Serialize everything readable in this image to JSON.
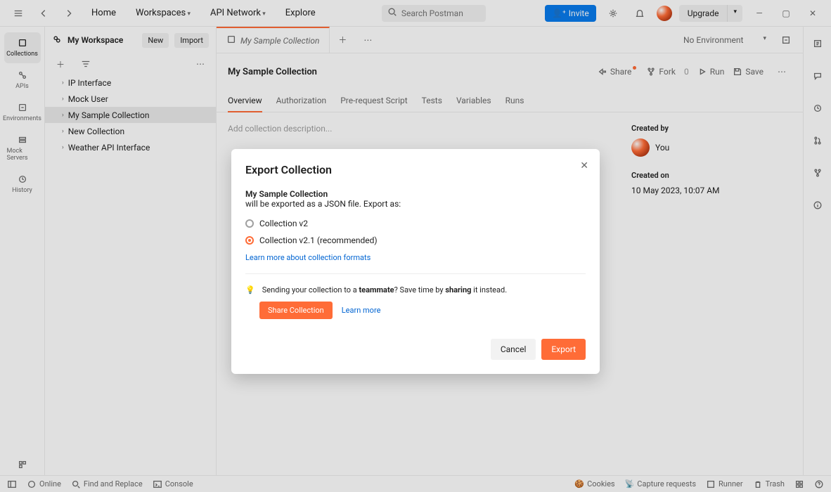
{
  "header": {
    "nav": {
      "home": "Home",
      "workspaces": "Workspaces",
      "api_network": "API Network",
      "explore": "Explore"
    },
    "search_placeholder": "Search Postman",
    "invite": "Invite",
    "upgrade": "Upgrade"
  },
  "rail": {
    "collections": "Collections",
    "apis": "APIs",
    "environments": "Environments",
    "mock_servers": "Mock Servers",
    "history": "History"
  },
  "sidebar": {
    "workspace": "My Workspace",
    "new": "New",
    "import": "Import",
    "items": [
      {
        "label": "IP Interface"
      },
      {
        "label": "Mock User"
      },
      {
        "label": "My Sample Collection"
      },
      {
        "label": "New Collection"
      },
      {
        "label": "Weather API Interface"
      }
    ]
  },
  "tabs": {
    "active": "My Sample Collection",
    "env": "No Environment"
  },
  "collection": {
    "name": "My Sample Collection",
    "actions": {
      "share": "Share",
      "fork": "Fork",
      "fork_count": "0",
      "run": "Run",
      "save": "Save"
    },
    "sub_tabs": [
      "Overview",
      "Authorization",
      "Pre-request Script",
      "Tests",
      "Variables",
      "Runs"
    ],
    "desc_placeholder": "Add collection description...",
    "created_by_lbl": "Created by",
    "created_by": "You",
    "created_on_lbl": "Created on",
    "created_on": "10 May 2023, 10:07 AM"
  },
  "modal": {
    "title": "Export Collection",
    "name": "My Sample Collection",
    "sub": "will be exported as a JSON file. Export as:",
    "opt1": "Collection v2",
    "opt2": "Collection v2.1 (recommended)",
    "learn_formats": "Learn more about collection formats",
    "tip_pre": "Sending your collection to a ",
    "tip_bold1": "teammate",
    "tip_mid": "? Save time by ",
    "tip_bold2": "sharing",
    "tip_post": " it instead.",
    "share_btn": "Share Collection",
    "learn_more": "Learn more",
    "cancel": "Cancel",
    "export": "Export"
  },
  "footer": {
    "online": "Online",
    "find": "Find and Replace",
    "console": "Console",
    "cookies": "Cookies",
    "capture": "Capture requests",
    "runner": "Runner",
    "trash": "Trash"
  }
}
